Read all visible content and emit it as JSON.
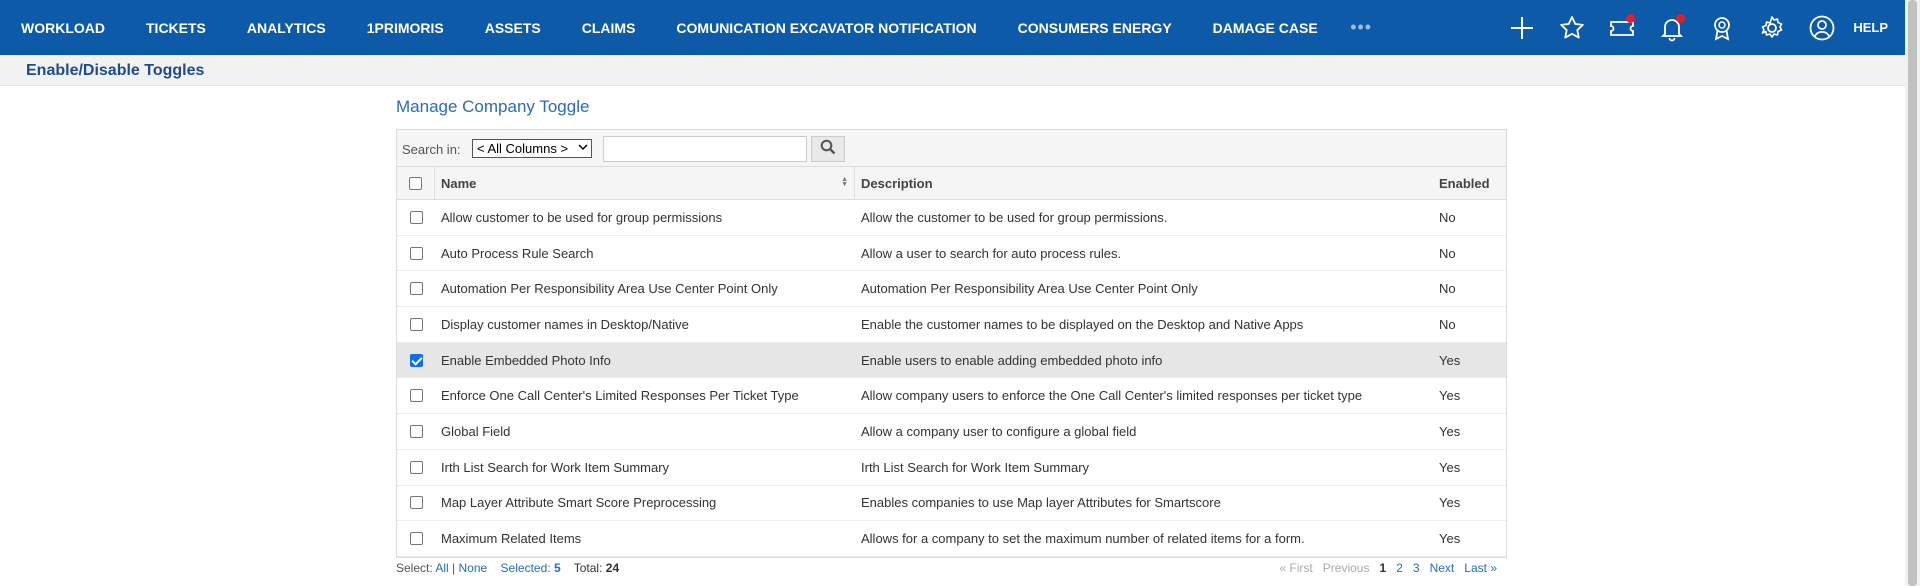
{
  "nav": {
    "items": [
      "WORKLOAD",
      "TICKETS",
      "ANALYTICS",
      "1PRIMORIS",
      "ASSETS",
      "CLAIMS",
      "COMUNICATION EXCAVATOR NOTIFICATION",
      "CONSUMERS ENERGY",
      "DAMAGE CASE"
    ],
    "more": "•••",
    "help": "HELP",
    "accent": "#0d5ba8",
    "icons": [
      "plus-icon",
      "star-icon",
      "ticket-icon",
      "bell-icon",
      "award-icon",
      "gear-icon",
      "user-icon"
    ]
  },
  "subheader": {
    "title": "Enable/Disable Toggles"
  },
  "main": {
    "title": "Manage Company Toggle"
  },
  "search": {
    "label": "Search in:",
    "select_value": "< All Columns >",
    "input_value": ""
  },
  "columns": {
    "name": "Name",
    "description": "Description",
    "enabled": "Enabled"
  },
  "rows": [
    {
      "name": "Allow customer to be used for group permissions",
      "description": "Allow the customer to be used for group permissions.",
      "enabled": "No",
      "checked": false
    },
    {
      "name": "Auto Process Rule Search",
      "description": "Allow a user to search for auto process rules.",
      "enabled": "No",
      "checked": false
    },
    {
      "name": "Automation Per Responsibility Area Use Center Point Only",
      "description": "Automation Per Responsibility Area Use Center Point Only",
      "enabled": "No",
      "checked": false
    },
    {
      "name": "Display customer names in Desktop/Native",
      "description": "Enable the customer names to be displayed on the Desktop and Native Apps",
      "enabled": "No",
      "checked": false
    },
    {
      "name": "Enable Embedded Photo Info",
      "description": "Enable users to enable adding embedded photo info",
      "enabled": "Yes",
      "checked": true
    },
    {
      "name": "Enforce One Call Center's Limited Responses Per Ticket Type",
      "description": "Allow company users to enforce the One Call Center's limited responses per ticket type",
      "enabled": "Yes",
      "checked": false
    },
    {
      "name": "Global Field",
      "description": "Allow a company user to configure a global field",
      "enabled": "Yes",
      "checked": false
    },
    {
      "name": "Irth List Search for Work Item Summary",
      "description": "Irth List Search for Work Item Summary",
      "enabled": "Yes",
      "checked": false
    },
    {
      "name": "Map Layer Attribute Smart Score Preprocessing",
      "description": "Enables companies to use Map layer Attributes for Smartscore",
      "enabled": "Yes",
      "checked": false
    },
    {
      "name": "Maximum Related Items",
      "description": "Allows for a company to set the maximum number of related items for a form.",
      "enabled": "Yes",
      "checked": false
    }
  ],
  "footer": {
    "select_label": "Select:",
    "all": "All",
    "sep": "|",
    "none": "None",
    "selected_label": "Selected:",
    "selected_count": "5",
    "total_label": "Total:",
    "total_count": "24",
    "first": "« First",
    "previous": "Previous",
    "pages": [
      "1",
      "2",
      "3"
    ],
    "next": "Next",
    "last": "Last »"
  }
}
